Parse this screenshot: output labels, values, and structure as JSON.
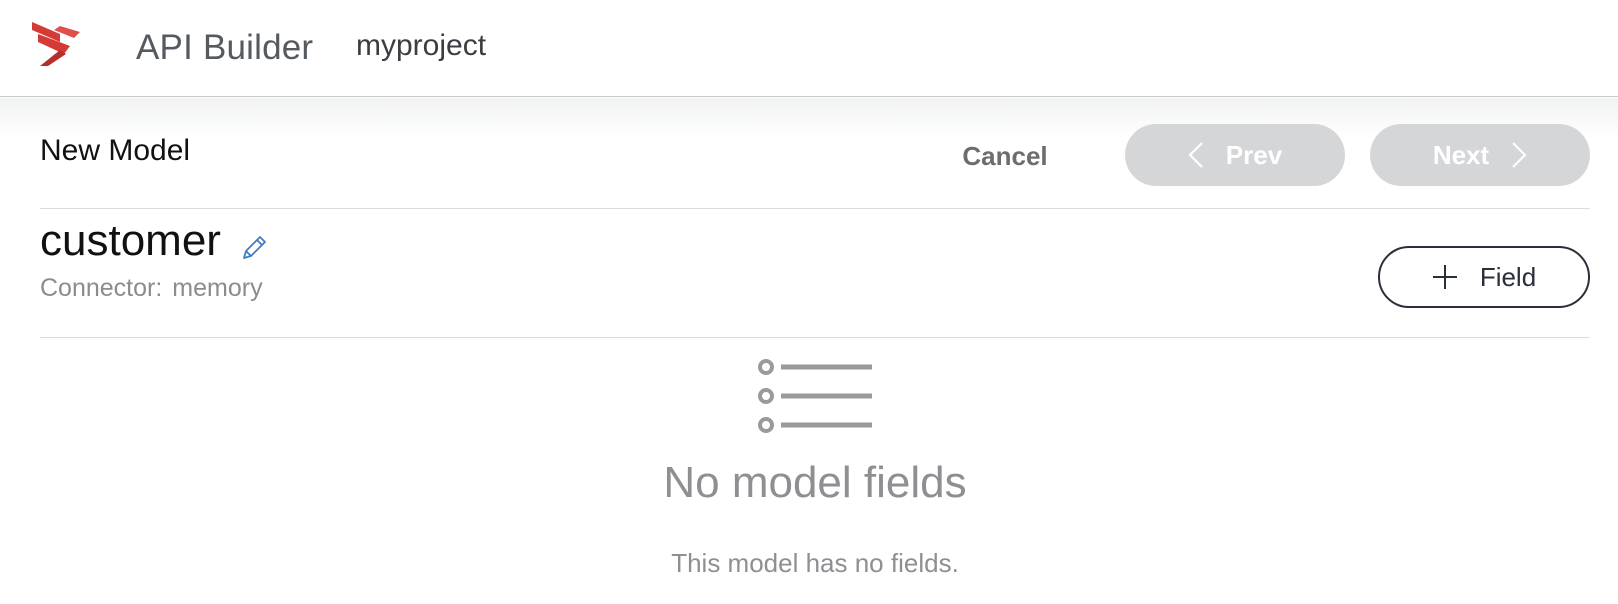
{
  "header": {
    "app_title": "API Builder",
    "project_name": "myproject",
    "logo_icon": "axway-logo-icon",
    "brand_color": "#d43a36"
  },
  "toolbar": {
    "page_title": "New Model",
    "cancel_label": "Cancel",
    "prev_label": "Prev",
    "next_label": "Next",
    "nav_disabled_color": "#d5d6d8"
  },
  "model": {
    "name": "customer",
    "connector_label": "Connector:",
    "connector_value": "memory",
    "add_field_label": "Field"
  },
  "empty_state": {
    "icon": "list-icon",
    "title": "No model fields",
    "message": "This model has no fields."
  }
}
